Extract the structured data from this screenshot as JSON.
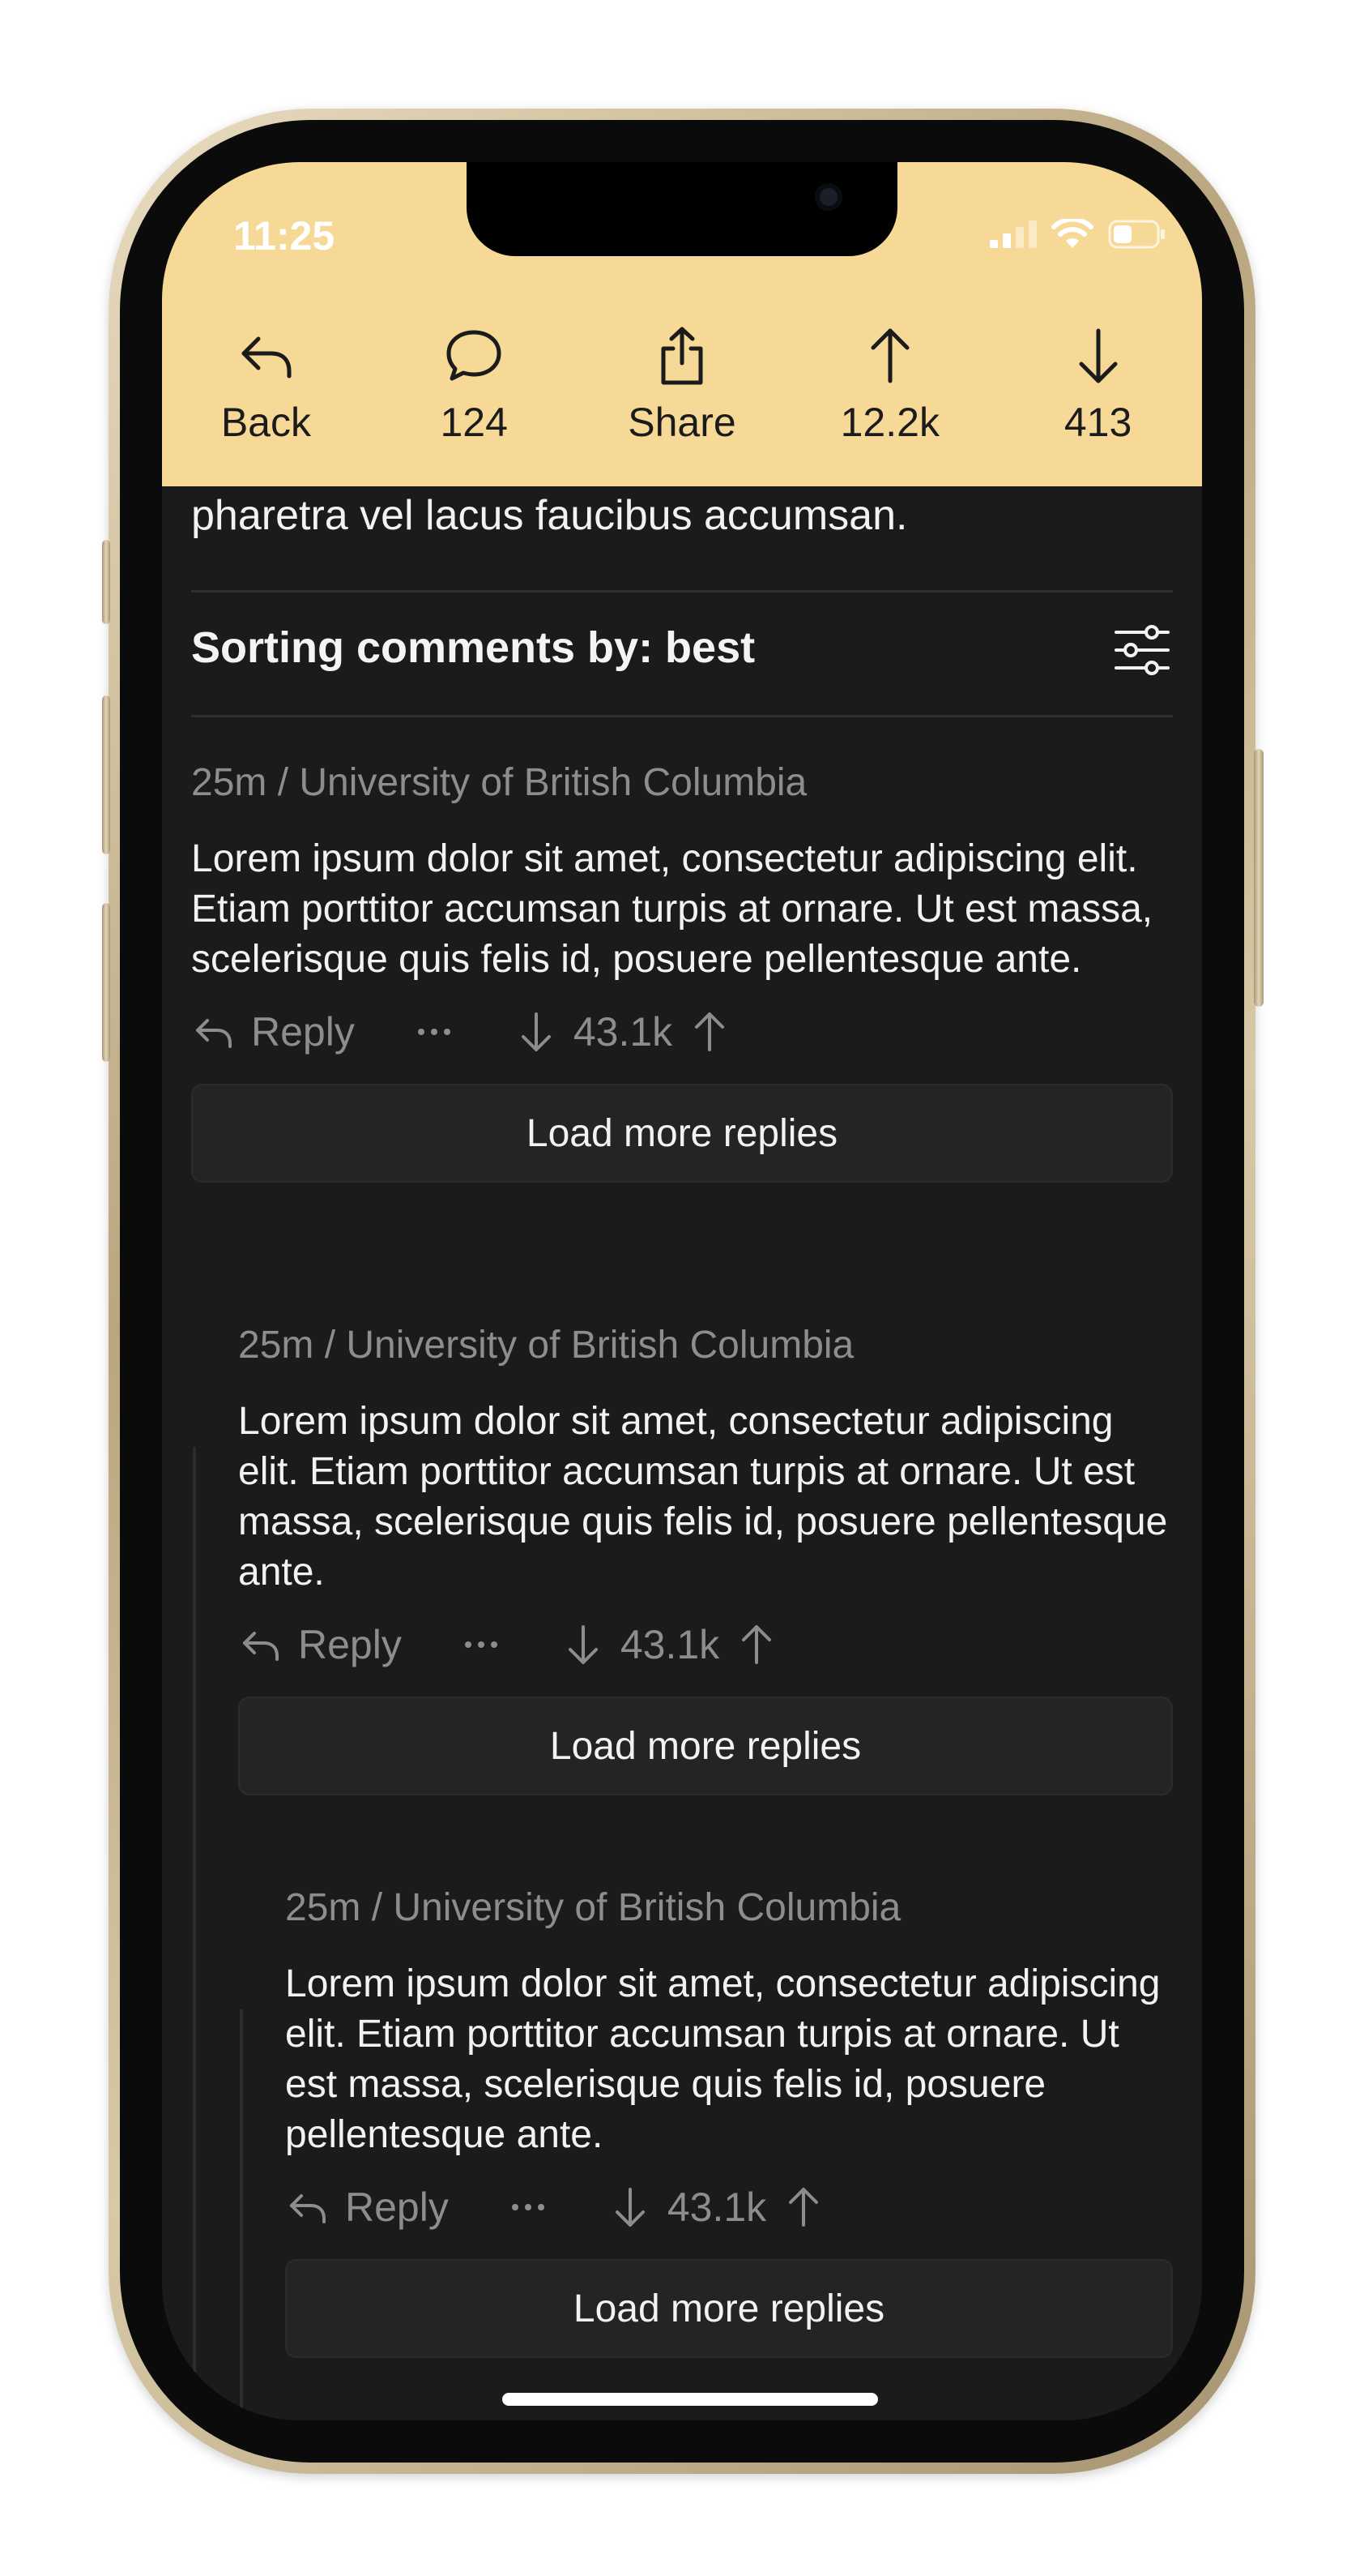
{
  "status_bar": {
    "time": "11:25",
    "icons": [
      "signal-icon",
      "wifi-icon",
      "battery-icon"
    ]
  },
  "toolbar": {
    "items": [
      {
        "icon": "back-arrow-icon",
        "label": "Back"
      },
      {
        "icon": "comment-bubble-icon",
        "label": "124"
      },
      {
        "icon": "share-icon",
        "label": "Share"
      },
      {
        "icon": "upvote-arrow-icon",
        "label": "12.2k"
      },
      {
        "icon": "downvote-arrow-icon",
        "label": "413"
      }
    ]
  },
  "post": {
    "body_tail": "pharetra vel lacus faucibus accumsan."
  },
  "sorting": {
    "title": "Sorting comments by: best",
    "icon": "filter-sliders-icon"
  },
  "comments": [
    {
      "meta": "25m / University of British Columbia",
      "text": "Lorem ipsum dolor sit amet, consectetur adipiscing elit. Etiam porttitor accumsan turpis at ornare. Ut est massa, scelerisque quis felis id, posuere pellentesque ante.",
      "reply_label": "Reply",
      "score": "43.1k",
      "load_more_label": "Load more replies"
    },
    {
      "meta": "25m / University of British Columbia",
      "text": "Lorem ipsum dolor sit amet, consectetur adipiscing elit. Etiam porttitor accumsan turpis at ornare. Ut est massa, scelerisque quis felis id, posuere pellentesque ante.",
      "reply_label": "Reply",
      "score": "43.1k",
      "load_more_label": "Load more replies"
    },
    {
      "meta": "25m / University of British Columbia",
      "text": "Lorem ipsum dolor sit amet, consectetur adipiscing elit. Etiam porttitor accumsan turpis at ornare. Ut est massa, scelerisque quis felis id, posuere pellentesque ante.",
      "reply_label": "Reply",
      "score": "43.1k",
      "load_more_label": "Load more replies"
    }
  ],
  "colors": {
    "header_bg": "#f6d996",
    "screen_bg": "#1b1b1b",
    "muted_text": "#8d8d8d",
    "primary_text": "#f2f2f2"
  }
}
